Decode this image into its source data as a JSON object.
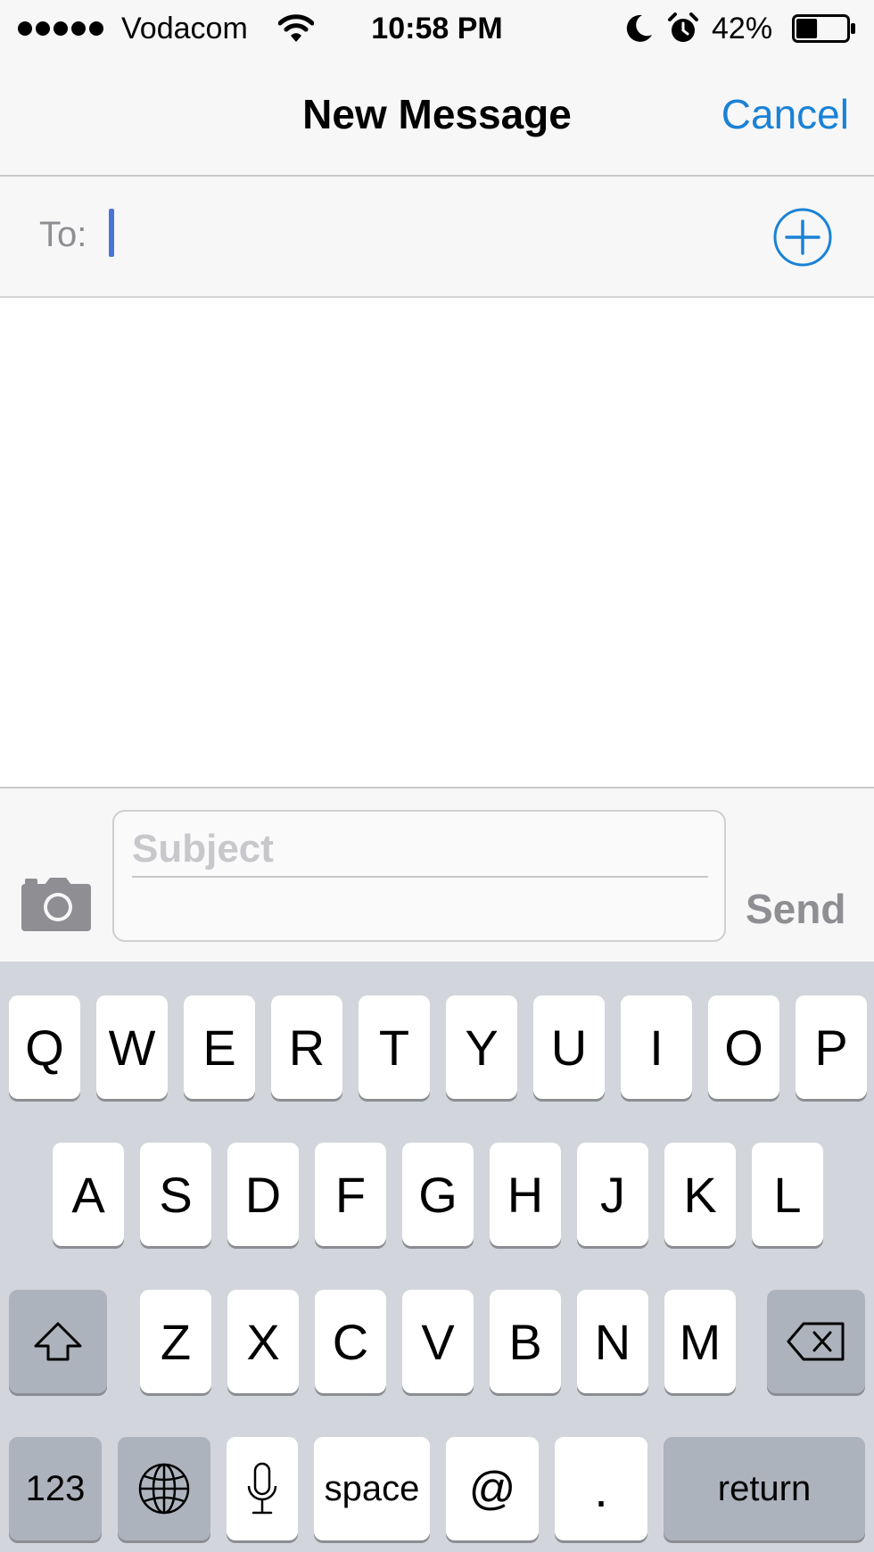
{
  "status_bar": {
    "carrier": "Vodacom",
    "time": "10:58 PM",
    "battery_percent": "42%",
    "battery_level": 0.42,
    "signal_bars": 5,
    "icons": [
      "signal-dots",
      "wifi-icon",
      "moon-icon",
      "alarm-icon",
      "battery-icon"
    ]
  },
  "nav": {
    "title": "New Message",
    "cancel_label": "Cancel"
  },
  "to_field": {
    "label": "To:",
    "value": ""
  },
  "compose": {
    "subject_placeholder": "Subject",
    "send_label": "Send"
  },
  "keyboard": {
    "row1": [
      "Q",
      "W",
      "E",
      "R",
      "T",
      "Y",
      "U",
      "I",
      "O",
      "P"
    ],
    "row2": [
      "A",
      "S",
      "D",
      "F",
      "G",
      "H",
      "J",
      "K",
      "L"
    ],
    "row3": [
      "Z",
      "X",
      "C",
      "V",
      "B",
      "N",
      "M"
    ],
    "bottom": {
      "numbers": "123",
      "space": "space",
      "at": "@",
      "period": ".",
      "return": "return"
    }
  },
  "colors": {
    "accent": "#1a82d6",
    "caret": "#4a74d8",
    "disabled_text": "#8e8e93",
    "placeholder": "#c7c7cc",
    "keyboard_bg": "#d2d5db",
    "dark_key": "#adb3bc"
  }
}
